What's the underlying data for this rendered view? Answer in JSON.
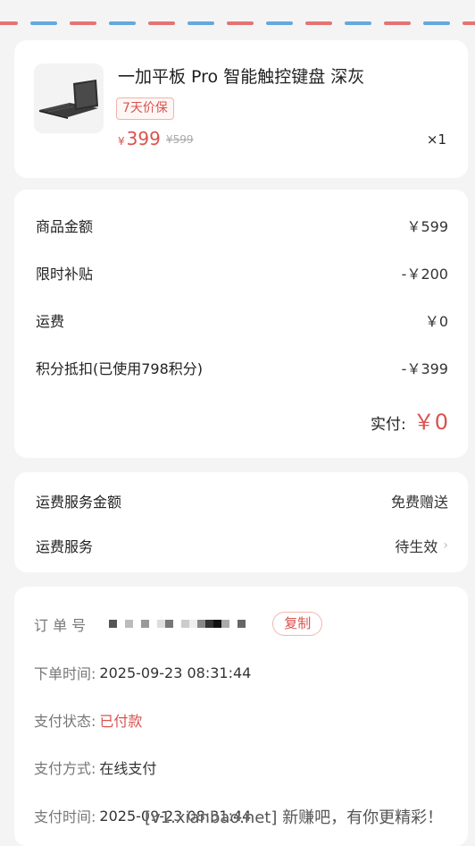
{
  "product": {
    "name": "一加平板 Pro 智能触控键盘 深灰",
    "tag": "7天价保",
    "currency": "¥",
    "price": "399",
    "original_price": "¥599",
    "quantity": "×1"
  },
  "price_breakdown": {
    "rows": [
      {
        "label": "商品金额",
        "value": "￥599"
      },
      {
        "label": "限时补贴",
        "value": "-￥200"
      },
      {
        "label": "运费",
        "value": "￥0"
      },
      {
        "label": "积分抵扣(已使用798积分)",
        "value": "-￥399"
      }
    ],
    "total_label": "实付:",
    "total_value": "￥0"
  },
  "shipping": {
    "service_amount_label": "运费服务金额",
    "service_amount_value": "免费赠送",
    "service_label": "运费服务",
    "service_value": "待生效"
  },
  "order": {
    "number_label": "订 单 号",
    "copy_label": "复制",
    "order_time_label": "下单时间:",
    "order_time_value": "2025-09-23 08:31:44",
    "pay_status_label": "支付状态:",
    "pay_status_value": "已付款",
    "pay_method_label": "支付方式:",
    "pay_method_value": "在线支付",
    "pay_time_label": "支付时间:",
    "pay_time_value": "2025-09-23 08:31:44"
  },
  "watermark": "[v1.xianbao.net] 新赚吧，有你更精彩！",
  "colors": {
    "accent_red": "#d9534f",
    "airmail_red": "#e57373",
    "airmail_blue": "#64a8dc"
  }
}
